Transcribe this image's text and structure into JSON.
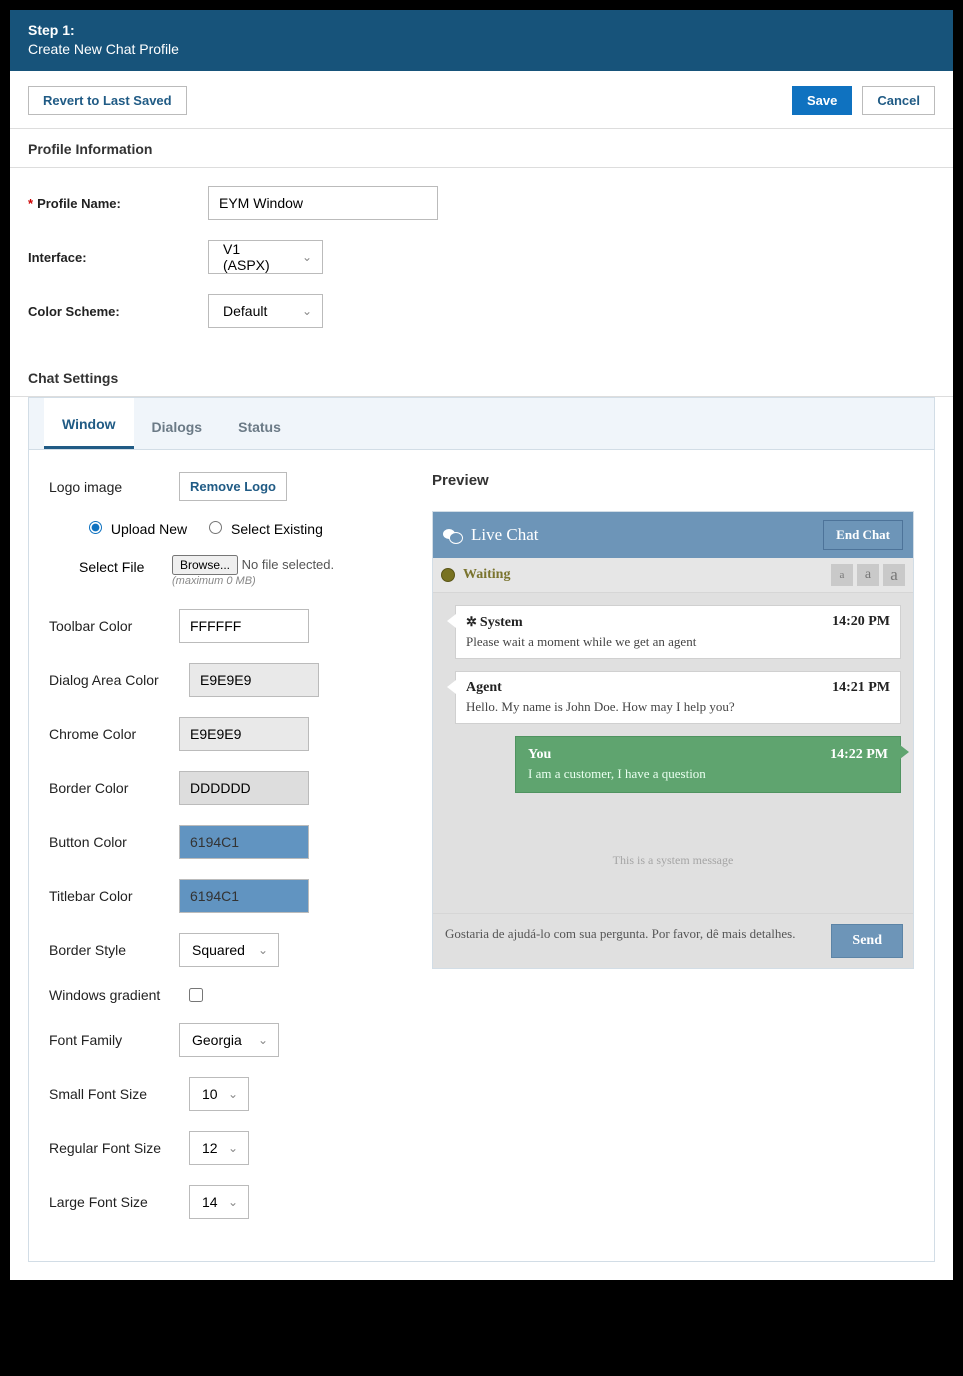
{
  "header": {
    "step": "Step 1:",
    "title": "Create New Chat Profile"
  },
  "buttons": {
    "revert": "Revert to Last Saved",
    "save": "Save",
    "cancel": "Cancel"
  },
  "sections": {
    "profile_info": {
      "title": "Profile Information",
      "profile_name_label": "Profile Name:",
      "profile_name_value": "EYM Window",
      "interface_label": "Interface:",
      "interface_value": "V1 (ASPX)",
      "color_scheme_label": "Color Scheme:",
      "color_scheme_value": "Default"
    },
    "chat_settings": {
      "title": "Chat Settings"
    }
  },
  "tabs": {
    "window": "Window",
    "dialogs": "Dialogs",
    "status": "Status"
  },
  "window_tab": {
    "logo_label": "Logo image",
    "remove_logo": "Remove Logo",
    "upload_new": "Upload New",
    "select_existing": "Select Existing",
    "select_file_label": "Select File",
    "browse": "Browse...",
    "no_file": "No file selected.",
    "max_hint": "(maximum 0 MB)",
    "toolbar_color_label": "Toolbar Color",
    "toolbar_color": "FFFFFF",
    "dialog_area_color_label": "Dialog Area Color",
    "dialog_area_color": "E9E9E9",
    "chrome_color_label": "Chrome Color",
    "chrome_color": "E9E9E9",
    "border_color_label": "Border Color",
    "border_color": "DDDDDD",
    "button_color_label": "Button Color",
    "button_color": "6194C1",
    "titlebar_color_label": "Titlebar Color",
    "titlebar_color": "6194C1",
    "border_style_label": "Border Style",
    "border_style": "Squared",
    "windows_gradient_label": "Windows gradient",
    "font_family_label": "Font Family",
    "font_family": "Georgia",
    "small_font_label": "Small Font Size",
    "small_font": "10",
    "regular_font_label": "Regular Font Size",
    "regular_font": "12",
    "large_font_label": "Large Font Size",
    "large_font": "14"
  },
  "preview": {
    "heading": "Preview",
    "chat_title": "Live Chat",
    "end_chat": "End Chat",
    "status": "Waiting",
    "messages": [
      {
        "who": "System",
        "time": "14:20 PM",
        "body": "Please wait a moment while we get an agent",
        "type": "system"
      },
      {
        "who": "Agent",
        "time": "14:21 PM",
        "body": "Hello. My name is John Doe. How may I help you?",
        "type": "agent"
      },
      {
        "who": "You",
        "time": "14:22 PM",
        "body": "I am a customer, I have a question",
        "type": "customer"
      }
    ],
    "system_message": "This is a system message",
    "input_text": "Gostaria de ajudá-lo com sua pergunta. Por favor, dê mais detalhes.",
    "send": "Send"
  }
}
